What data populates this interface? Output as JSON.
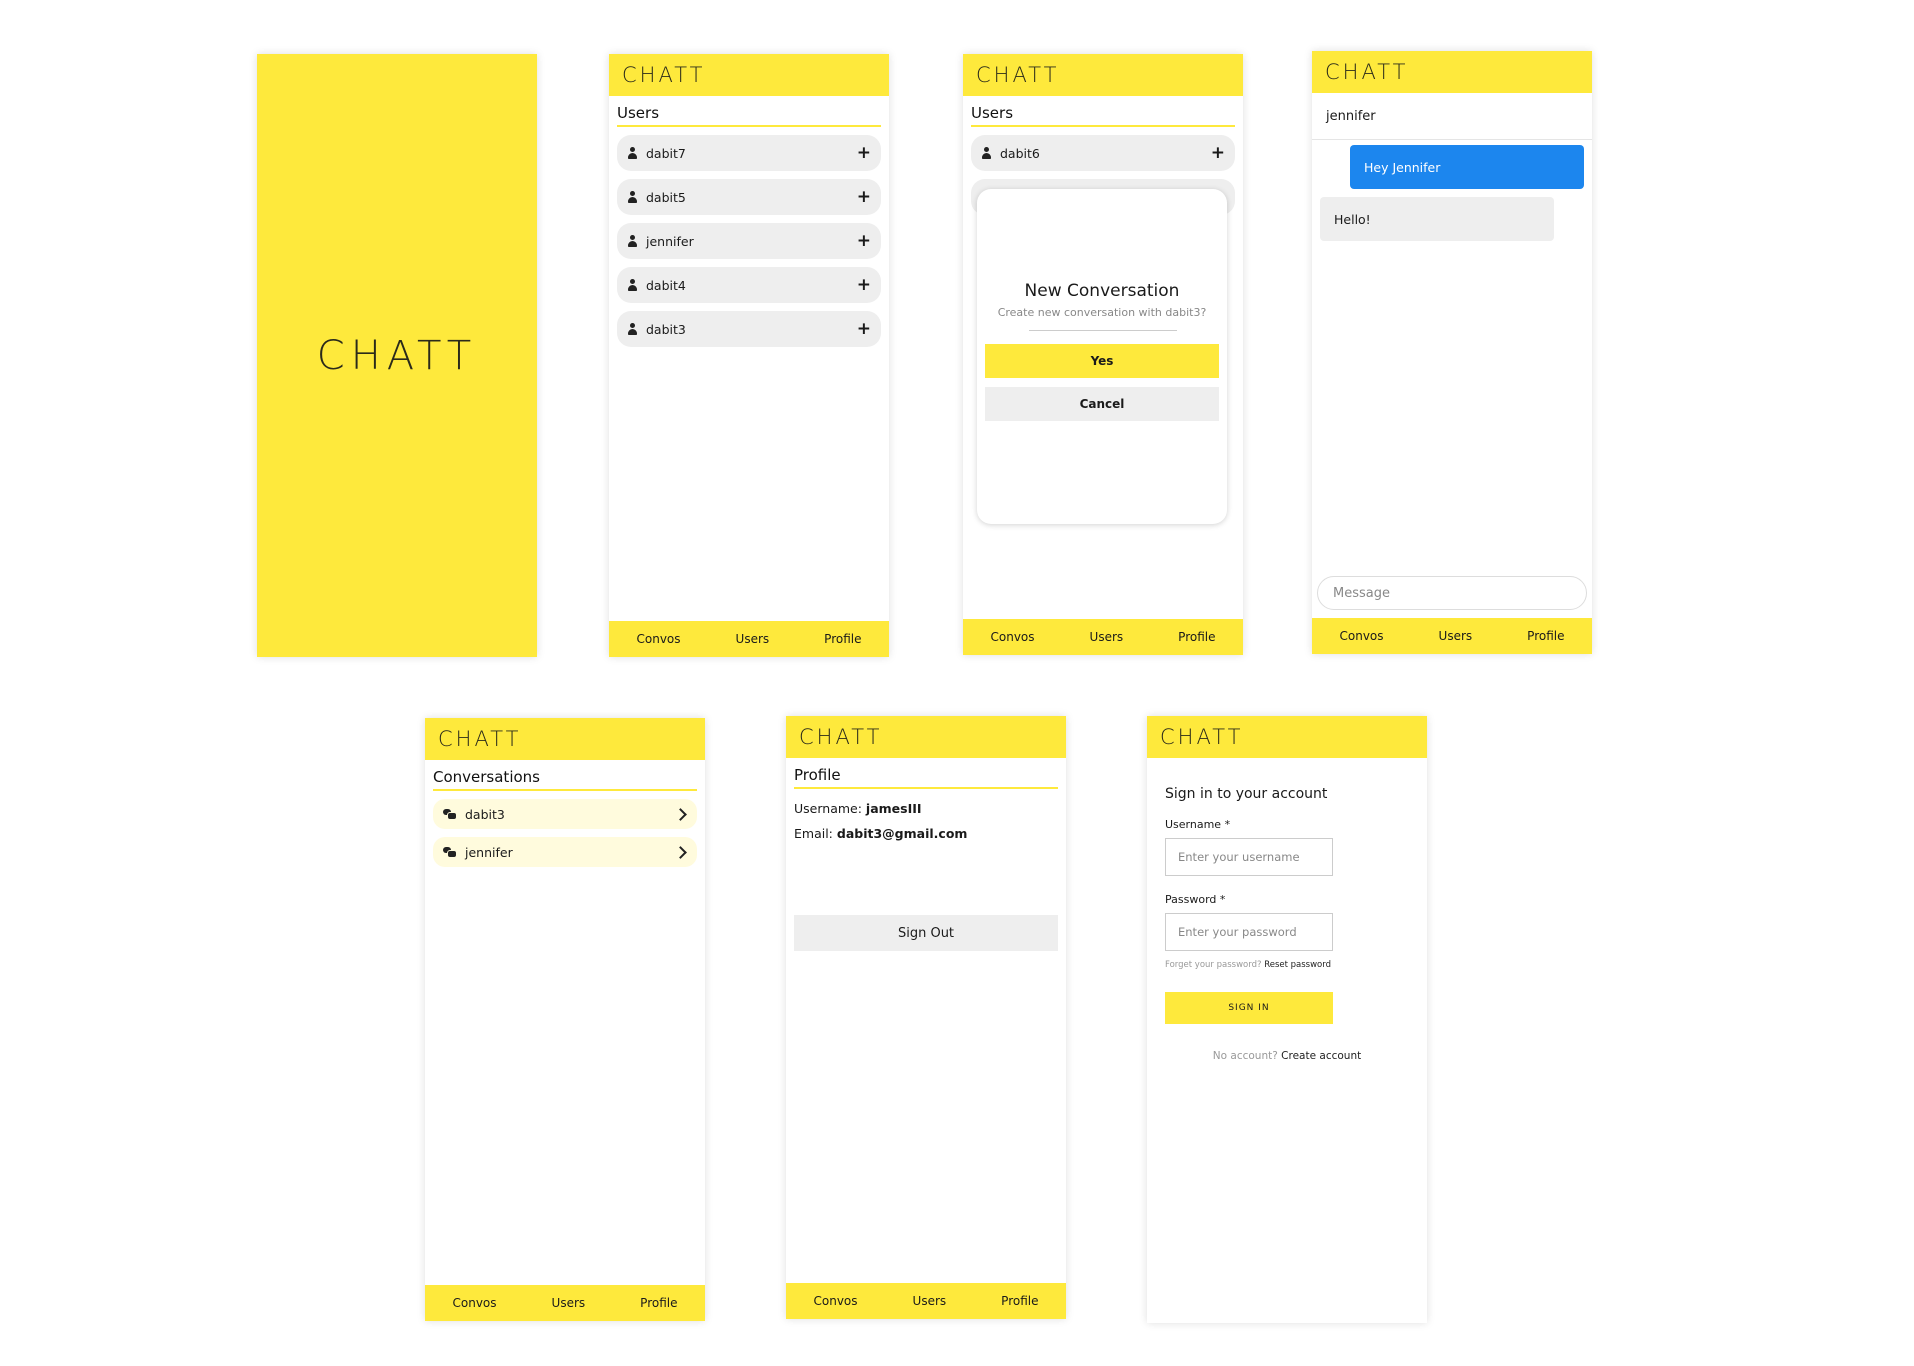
{
  "app": {
    "logo": "CHATT"
  },
  "nav": {
    "convos": "Convos",
    "users": "Users",
    "profile": "Profile"
  },
  "users_screen": {
    "title": "Users",
    "items": [
      "dabit7",
      "dabit5",
      "jennifer",
      "dabit4",
      "dabit3"
    ]
  },
  "modal_screen": {
    "title": "Users",
    "visible_user": "dabit6",
    "modal": {
      "title": "New Conversation",
      "subtitle": "Create new conversation with dabit3?",
      "yes": "Yes",
      "cancel": "Cancel"
    }
  },
  "chat_screen": {
    "contact": "jennifer",
    "messages": [
      {
        "from": "me",
        "text": "Hey Jennifer"
      },
      {
        "from": "them",
        "text": "Hello!"
      }
    ],
    "input_placeholder": "Message"
  },
  "convos_screen": {
    "title": "Conversations",
    "items": [
      "dabit3",
      "jennifer"
    ]
  },
  "profile_screen": {
    "title": "Profile",
    "username_label": "Username:",
    "username": "jamesIII",
    "email_label": "Email:",
    "email": "dabit3@gmail.com",
    "sign_out": "Sign Out"
  },
  "signin_screen": {
    "title": "Sign in to your account",
    "username_label": "Username *",
    "username_placeholder": "Enter your username",
    "password_label": "Password *",
    "password_placeholder": "Enter your password",
    "forgot_text": "Forget your password?",
    "reset_link": "Reset password",
    "sign_in_button": "SIGN IN",
    "no_account_text": "No account?",
    "create_link": "Create account"
  },
  "colors": {
    "yellow": "#FEE93C",
    "blue": "#1C86EE",
    "gray": "#eeeeee",
    "convo_bg": "#FFFBDD"
  }
}
